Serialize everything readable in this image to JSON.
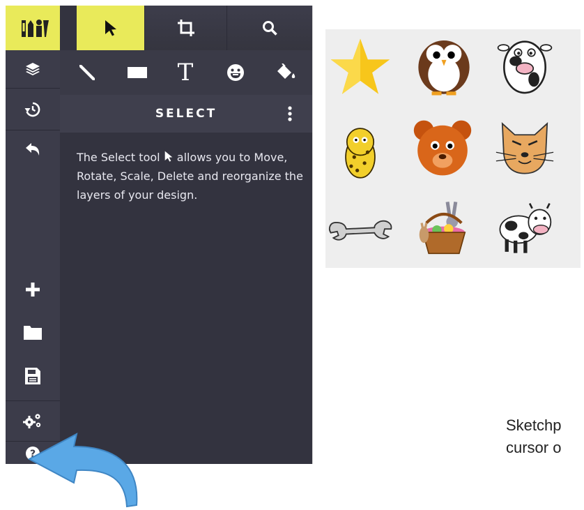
{
  "toolbar": {
    "row1": [
      "logo-icon",
      "select-icon",
      "crop-icon",
      "search-icon"
    ],
    "row2": [
      "pencil-icon",
      "rectangle-icon",
      "text-icon",
      "emoji-icon",
      "fill-icon"
    ],
    "text_tool_label": "T"
  },
  "rail": [
    "layers-icon",
    "history-icon",
    "undo-icon",
    "add-icon",
    "folder-icon",
    "save-icon",
    "settings-icon",
    "help-icon"
  ],
  "panel": {
    "title": "SELECT",
    "desc_before": "The Select tool ",
    "desc_after": " allows you to Move, Rotate, Scale, Delete and reorganize the layers of your design."
  },
  "gallery": [
    "star",
    "owl",
    "cow-face",
    "leopard",
    "bear",
    "cat",
    "wrench",
    "easter-basket",
    "cow"
  ],
  "hint": {
    "line1": "Sketchp",
    "line2": "cursor o"
  },
  "colors": {
    "accent": "#e9ea5a",
    "rail": "#3c3c4a",
    "panel": "#33333f",
    "arrow": "#5aa8e6"
  }
}
